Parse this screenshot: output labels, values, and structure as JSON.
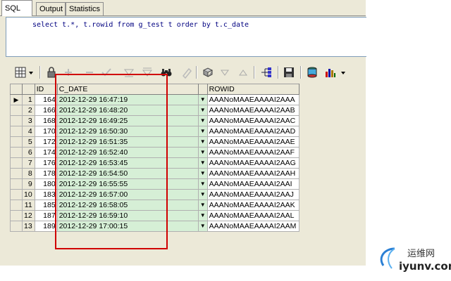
{
  "tabs": [
    {
      "label": "SQL",
      "active": true
    },
    {
      "label": "Output",
      "active": false
    },
    {
      "label": "Statistics",
      "active": false
    }
  ],
  "editor": {
    "sql": "select t.*, t.rowid from g_test t order by t.c_date"
  },
  "toolbar": {
    "buttons": [
      "grid-view-icon",
      "dropdown-arrow-icon",
      "lock-icon",
      "add-record-icon",
      "delete-record-icon",
      "post-checkmark-icon",
      "filter-down-icon",
      "filter-up-icon",
      "binoculars-icon",
      "clear-icon",
      "refresh-icon",
      "sort-down-icon",
      "sort-up-icon",
      "tree-icon",
      "save-icon",
      "print-icon",
      "chart-icon",
      "dropdown-arrow-icon"
    ]
  },
  "grid": {
    "columns": [
      "",
      "ID",
      "C_DATE",
      "",
      "ROWID"
    ],
    "rows": [
      {
        "num": "1",
        "id": "164",
        "c_date": "2012-12-29 16:47:19",
        "rowid": "AAANoMAAEAAAAI2AAA",
        "current": true
      },
      {
        "num": "2",
        "id": "166",
        "c_date": "2012-12-29 16:48:20",
        "rowid": "AAANoMAAEAAAAI2AAB"
      },
      {
        "num": "3",
        "id": "168",
        "c_date": "2012-12-29 16:49:25",
        "rowid": "AAANoMAAEAAAAI2AAC"
      },
      {
        "num": "4",
        "id": "170",
        "c_date": "2012-12-29 16:50:30",
        "rowid": "AAANoMAAEAAAAI2AAD"
      },
      {
        "num": "5",
        "id": "172",
        "c_date": "2012-12-29 16:51:35",
        "rowid": "AAANoMAAEAAAAI2AAE"
      },
      {
        "num": "6",
        "id": "174",
        "c_date": "2012-12-29 16:52:40",
        "rowid": "AAANoMAAEAAAAI2AAF"
      },
      {
        "num": "7",
        "id": "176",
        "c_date": "2012-12-29 16:53:45",
        "rowid": "AAANoMAAEAAAAI2AAG"
      },
      {
        "num": "8",
        "id": "178",
        "c_date": "2012-12-29 16:54:50",
        "rowid": "AAANoMAAEAAAAI2AAH"
      },
      {
        "num": "9",
        "id": "180",
        "c_date": "2012-12-29 16:55:55",
        "rowid": "AAANoMAAEAAAAI2AAI"
      },
      {
        "num": "10",
        "id": "183",
        "c_date": "2012-12-29 16:57:00",
        "rowid": "AAANoMAAEAAAAI2AAJ"
      },
      {
        "num": "11",
        "id": "185",
        "c_date": "2012-12-29 16:58:05",
        "rowid": "AAANoMAAEAAAAI2AAK"
      },
      {
        "num": "12",
        "id": "187",
        "c_date": "2012-12-29 16:59:10",
        "rowid": "AAANoMAAEAAAAI2AAL"
      },
      {
        "num": "13",
        "id": "189",
        "c_date": "2012-12-29 17:00:15",
        "rowid": "AAANoMAAEAAAAI2AAM"
      }
    ]
  },
  "watermark": {
    "title": "运维网",
    "url": "iyunv.com"
  },
  "colors": {
    "highlight": "#d00000",
    "date_cell": "#d6efd6",
    "toolbar": "#ece9d8"
  }
}
